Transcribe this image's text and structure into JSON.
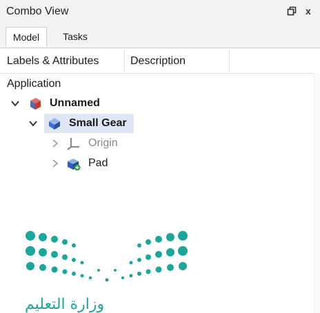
{
  "window": {
    "title": "Combo View",
    "float_glyph": "ᗡ",
    "close_glyph": "x"
  },
  "tabs": [
    {
      "label": "Model"
    },
    {
      "label": "Tasks"
    }
  ],
  "columns": [
    {
      "label": "Labels & Attributes"
    },
    {
      "label": "Description"
    }
  ],
  "tree": {
    "root_label": "Application",
    "items": [
      {
        "label": "Unnamed",
        "icon": "document-icon",
        "expanded": true
      },
      {
        "label": "Small Gear",
        "icon": "body-icon",
        "expanded": true,
        "selected": true
      },
      {
        "label": "Origin",
        "icon": "origin-axes-icon",
        "expanded": false,
        "greyed": true
      },
      {
        "label": "Pad",
        "icon": "pad-feature-icon",
        "expanded": false
      }
    ]
  },
  "watermark": {
    "brand": "ministry-logo",
    "script_text": "ﻭﺯﺍﺭﺓ ﺍﻟﺘﻌﻠﻴﻢ",
    "color": "#1aa69a"
  },
  "colors": {
    "accent": "#3b6fd6",
    "selection": "#dfe6f5",
    "logo": "#1aa69a"
  }
}
